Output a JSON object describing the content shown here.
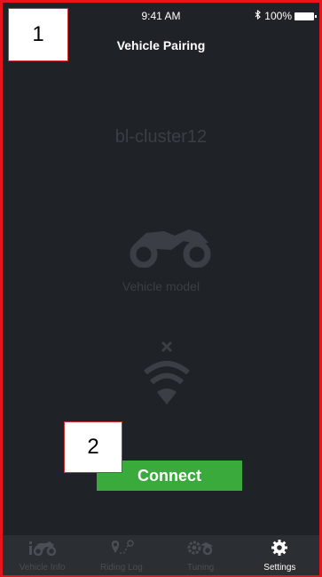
{
  "status": {
    "time": "9:41 AM",
    "battery": "100%"
  },
  "header": {
    "title": "Vehicle Pairing"
  },
  "device": {
    "name": "bl-cluster12",
    "model_label": "Vehicle model"
  },
  "actions": {
    "connect_label": "Connect"
  },
  "tabs": [
    {
      "label": "Vehicle Info",
      "icon": "vehicle-info-icon"
    },
    {
      "label": "Riding Log",
      "icon": "riding-log-icon"
    },
    {
      "label": "Tuning",
      "icon": "tuning-icon"
    },
    {
      "label": "Settings",
      "icon": "settings-icon",
      "active": true
    }
  ],
  "annotations": {
    "marker1": "1",
    "marker2": "2"
  },
  "colors": {
    "accent_green": "#3aaa3c",
    "background": "#1f2226",
    "frame_red": "#e8141c"
  }
}
